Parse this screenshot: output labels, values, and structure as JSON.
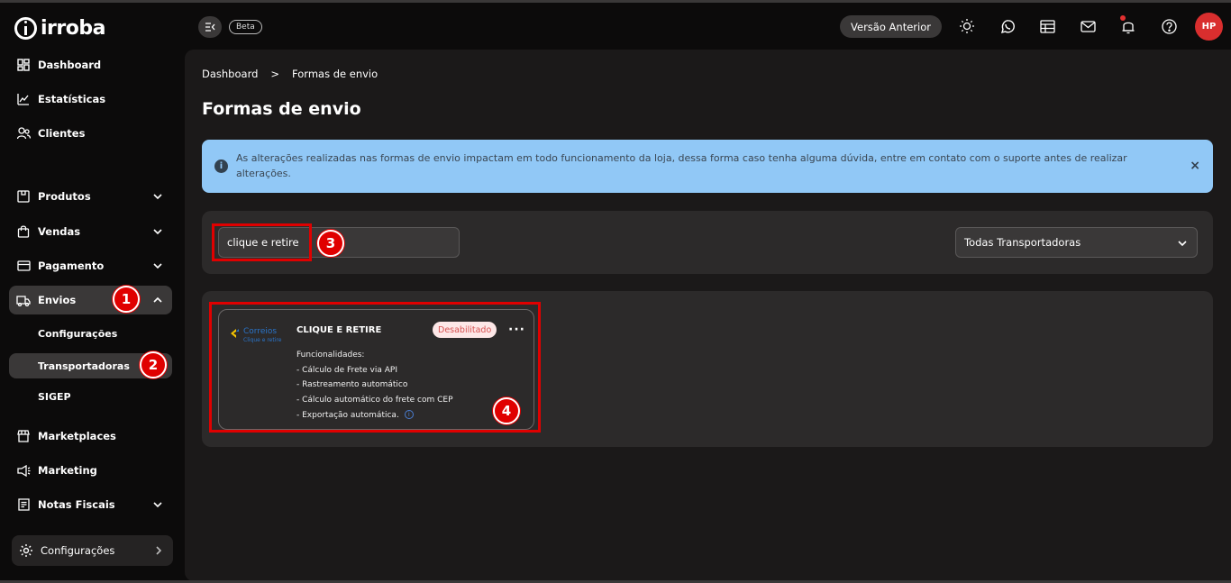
{
  "brand": {
    "logo_text": "irroba"
  },
  "sidebar": {
    "items": [
      {
        "label": "Dashboard",
        "icon": "dashboard-icon"
      },
      {
        "label": "Estatísticas",
        "icon": "chart-icon"
      },
      {
        "label": "Clientes",
        "icon": "users-icon"
      },
      {
        "label": "Produtos",
        "icon": "box-icon"
      },
      {
        "label": "Vendas",
        "icon": "shopping-bag-icon"
      },
      {
        "label": "Pagamento",
        "icon": "credit-card-icon"
      },
      {
        "label": "Envios",
        "icon": "truck-icon"
      },
      {
        "label": "Marketplaces",
        "icon": "store-icon"
      },
      {
        "label": "Marketing",
        "icon": "megaphone-icon"
      },
      {
        "label": "Notas Fiscais",
        "icon": "receipt-icon"
      }
    ],
    "envios_sub": [
      {
        "label": "Configurações"
      },
      {
        "label": "Transportadoras"
      },
      {
        "label": "SIGEP"
      }
    ],
    "bottom_config": "Configurações"
  },
  "header": {
    "beta": "Beta",
    "prev_version": "Versão Anterior",
    "avatar_initials": "HP"
  },
  "breadcrumb": {
    "home": "Dashboard",
    "sep": ">",
    "current": "Formas de envio"
  },
  "page_title": "Formas de envio",
  "alert": {
    "icon": "i",
    "message": "As alterações realizadas nas formas de envio impactam em todo funcionamento da loja, dessa forma caso tenha alguma dúvida, entre em contato com o suporte antes de realizar alterações.",
    "close": "×"
  },
  "filters": {
    "search_value": "clique e retire",
    "carrier_select": "Todas Transportadoras"
  },
  "card": {
    "logo_brand": "Correios",
    "logo_sub": "Clique e retire",
    "title": "CLIQUE E RETIRE",
    "status": "Desabilitado",
    "menu": "···",
    "features_title": "Funcionalidades:",
    "features": [
      "- Cálculo de Frete via API",
      "- Rastreamento automático",
      "- Cálculo automático do frete com CEP",
      "- Exportação automática."
    ],
    "info_glyph": "i"
  },
  "annotations": [
    "1",
    "2",
    "3",
    "4"
  ],
  "colors": {
    "highlight": "#e00000",
    "avatar": "#d92e2e",
    "alert_bg": "#91c8f6",
    "badge_bg": "#fde7e7",
    "badge_text": "#d65151"
  }
}
